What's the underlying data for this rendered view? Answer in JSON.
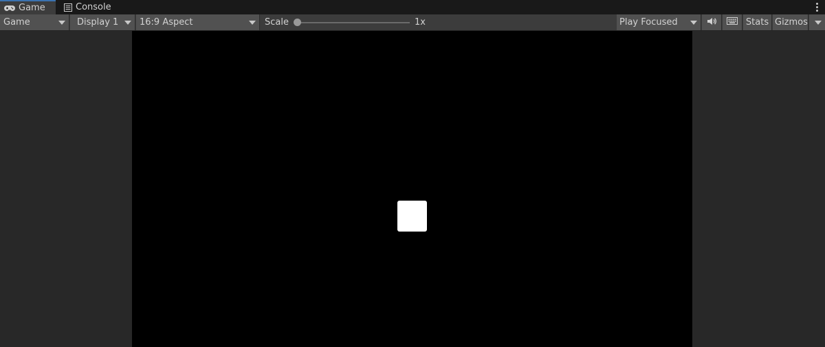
{
  "tabs": [
    {
      "label": "Game",
      "icon": "gamepad-icon",
      "active": true
    },
    {
      "label": "Console",
      "icon": "console-icon",
      "active": false
    }
  ],
  "toolbar": {
    "view_select": "Game",
    "display_select": "Display 1",
    "aspect_select": "16:9 Aspect",
    "scale_label": "Scale",
    "scale_value": "1x",
    "play_mode": "Play Focused",
    "audio_icon": "speaker-icon",
    "keyboard_icon": "keyboard-icon",
    "stats_label": "Stats",
    "gizmos_label": "Gizmos"
  },
  "colors": {
    "tab_accent": "#3a72b0",
    "toolbar_bg": "#3c3c3c",
    "game_view_bg": "#000000",
    "cube": "#ffffff"
  }
}
